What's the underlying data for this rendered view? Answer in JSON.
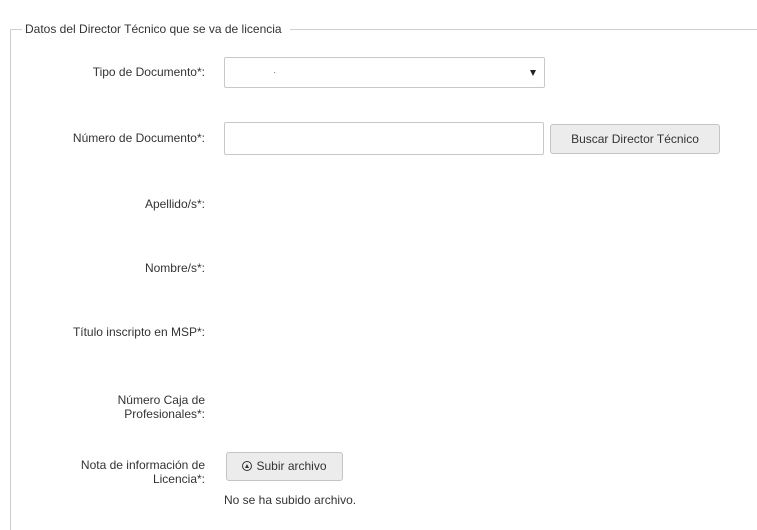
{
  "fieldset": {
    "legend": "Datos del Director Técnico que se va de licencia"
  },
  "form": {
    "tipo_documento": {
      "label": "Tipo de Documento*:",
      "selected_value": "·"
    },
    "numero_documento": {
      "label": "Número de Documento*:",
      "value": "",
      "search_button_label": "Buscar Director Técnico"
    },
    "apellidos": {
      "label": "Apellido/s*:"
    },
    "nombres": {
      "label": "Nombre/s*:"
    },
    "titulo": {
      "label": "Título inscripto en MSP*:"
    },
    "caja_profesionales": {
      "label_line1": "Número Caja de",
      "label_line2": "Profesionales*:"
    },
    "nota_licencia": {
      "label_line1": "Nota de información de",
      "label_line2": "Licencia*:",
      "upload_button_label": "Subir archivo",
      "upload_icon": "upload-circle-icon",
      "status": "No se ha subido archivo."
    }
  }
}
